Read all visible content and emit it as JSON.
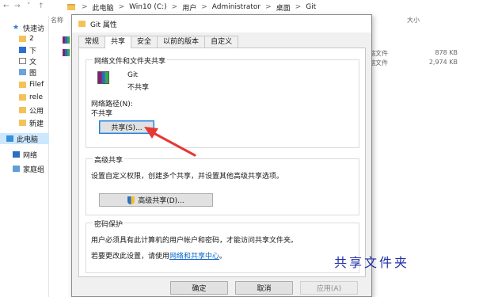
{
  "explorer": {
    "address": {
      "nav_icons": [
        "back-icon",
        "forward-icon",
        "up-icon"
      ],
      "crumbs": [
        "此电脑",
        "Win10 (C:)",
        "用户",
        "Administrator",
        "桌面",
        "Git"
      ],
      "separator": ">"
    },
    "columns": {
      "name": "名称",
      "size": "大小"
    },
    "files": [
      {
        "type": "压缩文件",
        "size": "878 KB"
      },
      {
        "type": "压缩文件",
        "size": "2,974 KB"
      }
    ],
    "sidebar": [
      {
        "label": "快速访",
        "icon": "star-icon"
      },
      {
        "label": "2",
        "icon": "folder-icon"
      },
      {
        "label": "下",
        "icon": "download-icon"
      },
      {
        "label": "文",
        "icon": "document-icon"
      },
      {
        "label": "图",
        "icon": "picture-icon"
      },
      {
        "label": "Filef",
        "icon": "folder-icon"
      },
      {
        "label": "rele",
        "icon": "folder-icon"
      },
      {
        "label": "公用",
        "icon": "folder-icon"
      },
      {
        "label": "新建",
        "icon": "folder-icon"
      },
      {
        "label": "此电脑",
        "icon": "computer-icon"
      },
      {
        "label": "网络",
        "icon": "network-icon"
      },
      {
        "label": "家庭组",
        "icon": "homegroup-icon"
      }
    ]
  },
  "dialog": {
    "title": "Git 属性",
    "tabs": [
      "常规",
      "共享",
      "安全",
      "以前的版本",
      "自定义"
    ],
    "active_tab": "共享",
    "network_share": {
      "group_title": "网络文件和文件夹共享",
      "folder_name": "Git",
      "status": "不共享",
      "path_label": "网络路径(N):",
      "path_value": "不共享",
      "share_button": "共享(S)..."
    },
    "advanced": {
      "group_title": "高级共享",
      "description": "设置自定义权限，创建多个共享，并设置其他高级共享选项。",
      "button": "高级共享(D)..."
    },
    "password": {
      "group_title": "密码保护",
      "description": "用户必须具有此计算机的用户帐户和密码，才能访问共享文件夹。",
      "change_prefix": "若要更改此设置，请使用",
      "change_link": "网络和共享中心",
      "change_suffix": "。"
    },
    "buttons": {
      "ok": "确定",
      "cancel": "取消",
      "apply": "应用(A)"
    }
  },
  "annotation": {
    "text": "共享文件夹",
    "color": "#1f2ea6",
    "arrow_color": "#e53935"
  },
  "colors": {
    "focus_border": "#2a7fd4",
    "link": "#0a64c8",
    "selected_sidebar": "#cce8ff"
  }
}
